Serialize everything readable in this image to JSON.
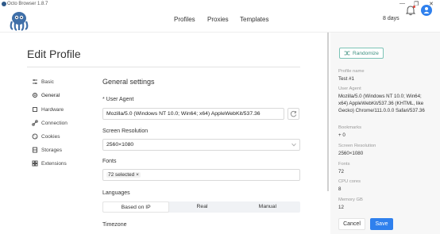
{
  "window": {
    "title": "Octo Browser 1.8.7"
  },
  "topnav": {
    "profiles": "Profiles",
    "proxies": "Proxies",
    "templates": "Templates",
    "days": "8 days"
  },
  "page": {
    "title": "Edit Profile"
  },
  "sidebar": {
    "items": [
      {
        "label": "Basic",
        "icon": "settings-sliders-icon"
      },
      {
        "label": "General",
        "icon": "gear-icon"
      },
      {
        "label": "Hardware",
        "icon": "chip-icon"
      },
      {
        "label": "Connection",
        "icon": "link-icon"
      },
      {
        "label": "Cookies",
        "icon": "cookie-icon"
      },
      {
        "label": "Storages",
        "icon": "database-icon"
      },
      {
        "label": "Extensions",
        "icon": "puzzle-icon"
      }
    ]
  },
  "general": {
    "section_title": "General settings",
    "user_agent_label": "User Agent",
    "user_agent_value": "Mozilla/5.0 (Windows NT 10.0; Win64; x64) AppleWebKit/537.36",
    "screen_resolution_label": "Screen Resolution",
    "screen_resolution_value": "2560×1080",
    "fonts_label": "Fonts",
    "fonts_value": "72 selected",
    "languages_label": "Languages",
    "language_options": [
      "Based on IP",
      "Real",
      "Manual"
    ],
    "timezone_label": "Timezone"
  },
  "panel": {
    "randomize_label": "Randomize",
    "profile_name_key": "Profile name",
    "profile_name_value": "Test #1",
    "user_agent_key": "User Agent",
    "user_agent_value": "Mozilla/5.0 (Windows NT 10.0; Win64; x64) AppleWebKit/537.36 (KHTML, like Gecko) Chrome/111.0.0.0 Safari/537.36",
    "bookmarks_key": "Bookmarks",
    "bookmarks_value": "+ 0",
    "screen_resolution_key": "Screen Resolution",
    "screen_resolution_value": "2560×1080",
    "fonts_key": "Fonts",
    "fonts_value": "72",
    "cpu_key": "CPU cores",
    "cpu_value": "8",
    "memory_key": "Memory GB",
    "memory_value": "12",
    "cancel_label": "Cancel",
    "save_label": "Save"
  },
  "colors": {
    "accent": "#2f80ed",
    "randomize": "#3d8f7f"
  }
}
